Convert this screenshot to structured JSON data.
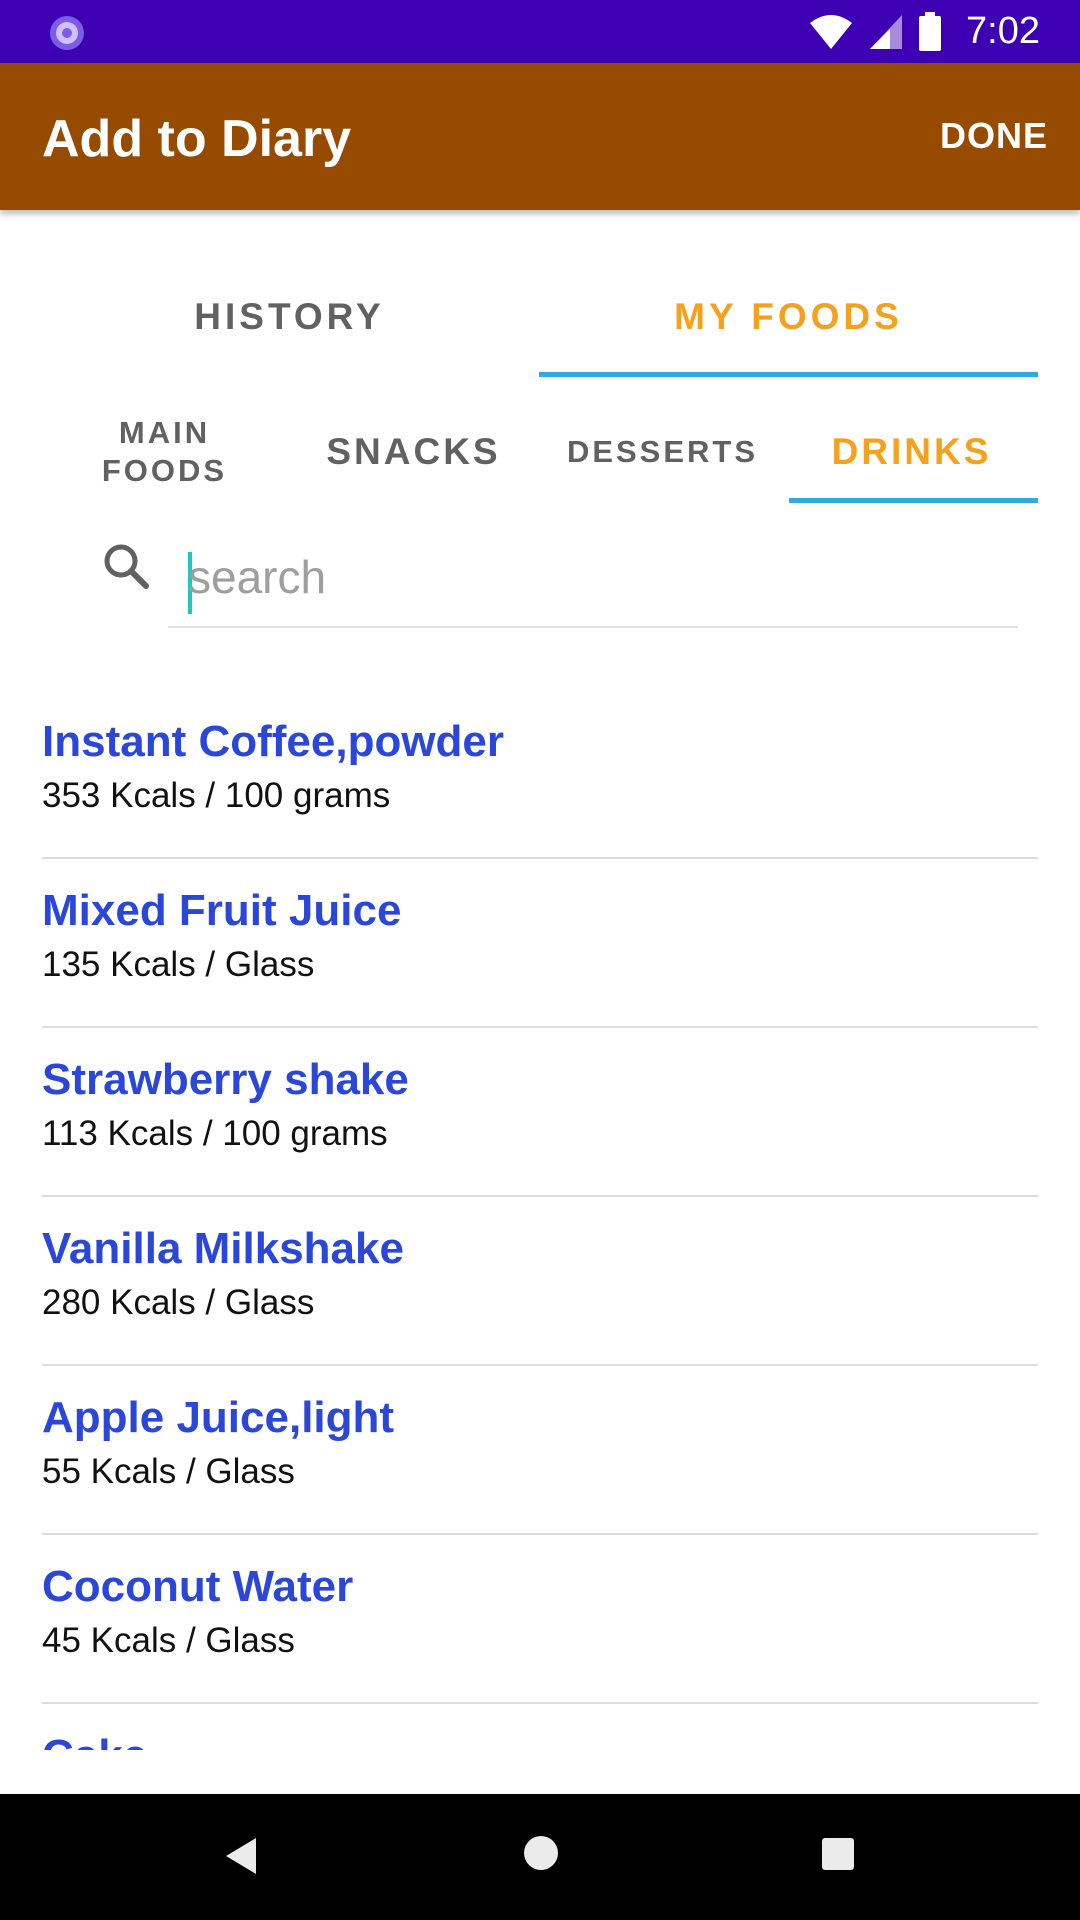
{
  "status_bar": {
    "time": "7:02",
    "icons": [
      "notification-icon",
      "wifi-icon",
      "signal-icon",
      "battery-icon"
    ]
  },
  "app_bar": {
    "title": "Add to Diary",
    "done_label": "DONE",
    "background": "#964b00"
  },
  "top_tabs": [
    {
      "label": "HISTORY",
      "selected": false
    },
    {
      "label": "MY FOODS",
      "selected": true
    }
  ],
  "sub_tabs": [
    {
      "label": "MAIN\nFOODS",
      "selected": false
    },
    {
      "label": "SNACKS",
      "selected": false
    },
    {
      "label": "DESSERTS",
      "selected": false
    },
    {
      "label": "DRINKS",
      "selected": true
    }
  ],
  "search": {
    "placeholder": "search",
    "value": ""
  },
  "foods": [
    {
      "name": "Instant Coffee,powder",
      "detail": "353 Kcals / 100 grams"
    },
    {
      "name": "Mixed Fruit Juice",
      "detail": "135 Kcals / Glass"
    },
    {
      "name": "Strawberry shake",
      "detail": "113 Kcals / 100 grams"
    },
    {
      "name": "Vanilla Milkshake",
      "detail": "280 Kcals / Glass"
    },
    {
      "name": "Apple Juice,light",
      "detail": "55 Kcals / Glass"
    },
    {
      "name": "Coconut Water",
      "detail": "45 Kcals / Glass"
    },
    {
      "name": "Cake",
      "detail": ""
    }
  ],
  "colors": {
    "status_bar": "#3d00b3",
    "accent": "#f5a11e",
    "indicator": "#2fa9e0",
    "food_name": "#2b47d9"
  },
  "nav_bar": {
    "icons": [
      "back-icon",
      "home-icon",
      "recents-icon"
    ]
  }
}
